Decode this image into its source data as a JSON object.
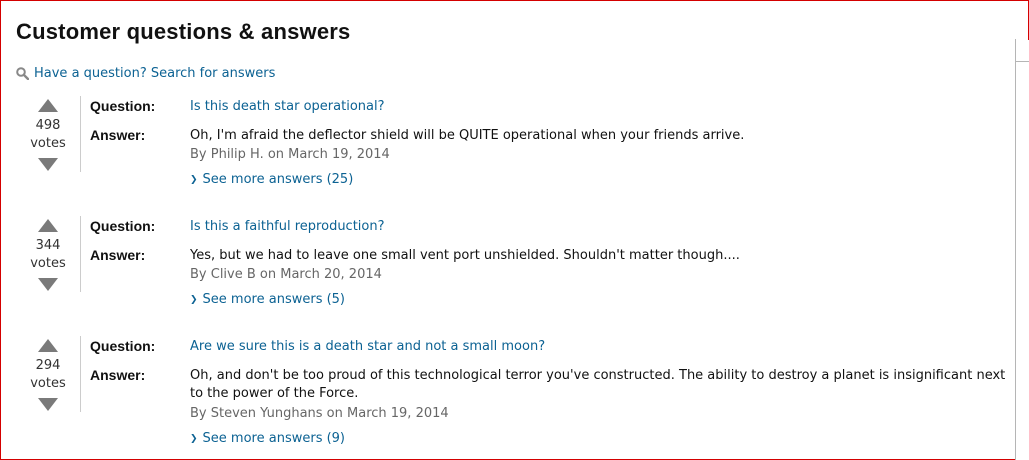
{
  "heading": "Customer questions & answers",
  "search_link": {
    "icon": "search-icon",
    "label": "Have a question? Search for answers"
  },
  "labels": {
    "question": "Question:",
    "answer": "Answer:"
  },
  "questions": [
    {
      "votes": "498",
      "votes_label": "votes",
      "question": "Is this death star operational?",
      "answer": "Oh, I'm afraid the deflector shield will be QUITE operational when your friends arrive.",
      "byline": "By Philip H. on March 19, 2014",
      "see_more": "See more answers (25)"
    },
    {
      "votes": "344",
      "votes_label": "votes",
      "question": "Is this a faithful reproduction?",
      "answer": "Yes, but we had to leave one small vent port unshielded. Shouldn't matter though....",
      "byline": "By Clive B on March 20, 2014",
      "see_more": "See more answers (5)"
    },
    {
      "votes": "294",
      "votes_label": "votes",
      "question": "Are we sure this is a death star and not a small moon?",
      "answer": "Oh, and don't be too proud of this technological terror you've constructed. The ability to destroy a planet is insignificant next to the power of the Force.",
      "byline": "By Steven Yunghans on March 19, 2014",
      "see_more": "See more answers (9)"
    }
  ],
  "colors": {
    "link": "#0c6293",
    "arrow": "#7a7a7a",
    "frame": "#d40000"
  }
}
